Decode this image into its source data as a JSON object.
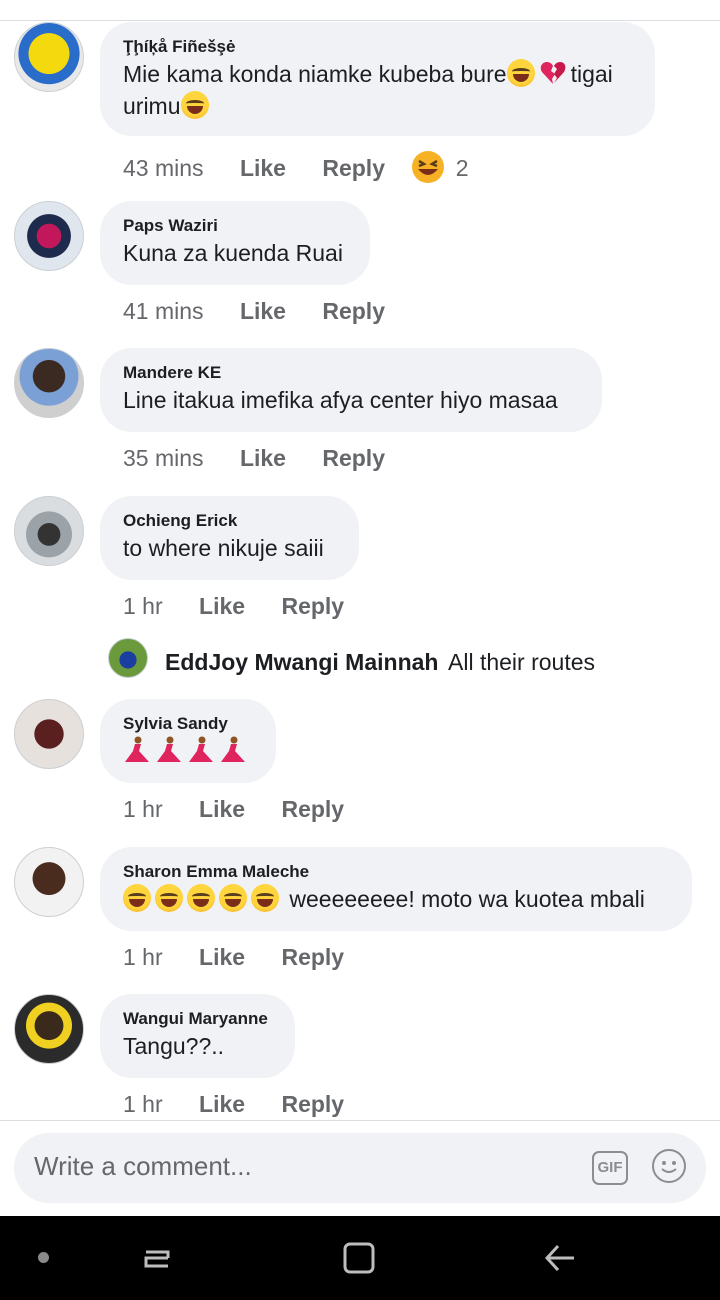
{
  "comments": [
    {
      "author": "Ţḩíķå Fiñešşė",
      "text": "Mie kama konda niamke kubeba bure",
      "text2": "tigai",
      "text3": "urimu",
      "time": "43 mins",
      "like": "Like",
      "reply": "Reply",
      "reaction_count": "2"
    },
    {
      "author": "Paps Waziri",
      "text": "Kuna za kuenda Ruai",
      "time": "41 mins",
      "like": "Like",
      "reply": "Reply"
    },
    {
      "author": "Mandere KE",
      "text": "Line itakua imefika afya center hiyo masaa",
      "time": "35 mins",
      "like": "Like",
      "reply": "Reply"
    },
    {
      "author": "Ochieng Erick",
      "text": "to where nikuje saiii",
      "time": "1 hr",
      "like": "Like",
      "reply": "Reply"
    },
    {
      "author": "Sylvia Sandy",
      "text": "",
      "time": "1 hr",
      "like": "Like",
      "reply": "Reply"
    },
    {
      "author": "Sharon Emma Maleche",
      "text": "weeeeeeee! moto wa kuotea mbali",
      "time": "1 hr",
      "like": "Like",
      "reply": "Reply"
    },
    {
      "author": "Wangui Maryanne",
      "text": "Tangu??..",
      "time": "1 hr",
      "like": "Like",
      "reply": "Reply"
    }
  ],
  "reply_preview": {
    "author": "EddJoy Mwangi Mainnah",
    "text": "All their routes"
  },
  "composer": {
    "placeholder": "Write a comment...",
    "gif_label": "GIF"
  },
  "icons": {
    "gif": "gif-icon",
    "emoji": "emoji-icon",
    "home": "home-dot-icon",
    "recents": "recents-icon",
    "overview": "overview-icon",
    "back": "back-icon"
  },
  "colors": {
    "bubble": "#f0f2f5",
    "meta_text": "#65676b",
    "navbar": "#000000"
  }
}
